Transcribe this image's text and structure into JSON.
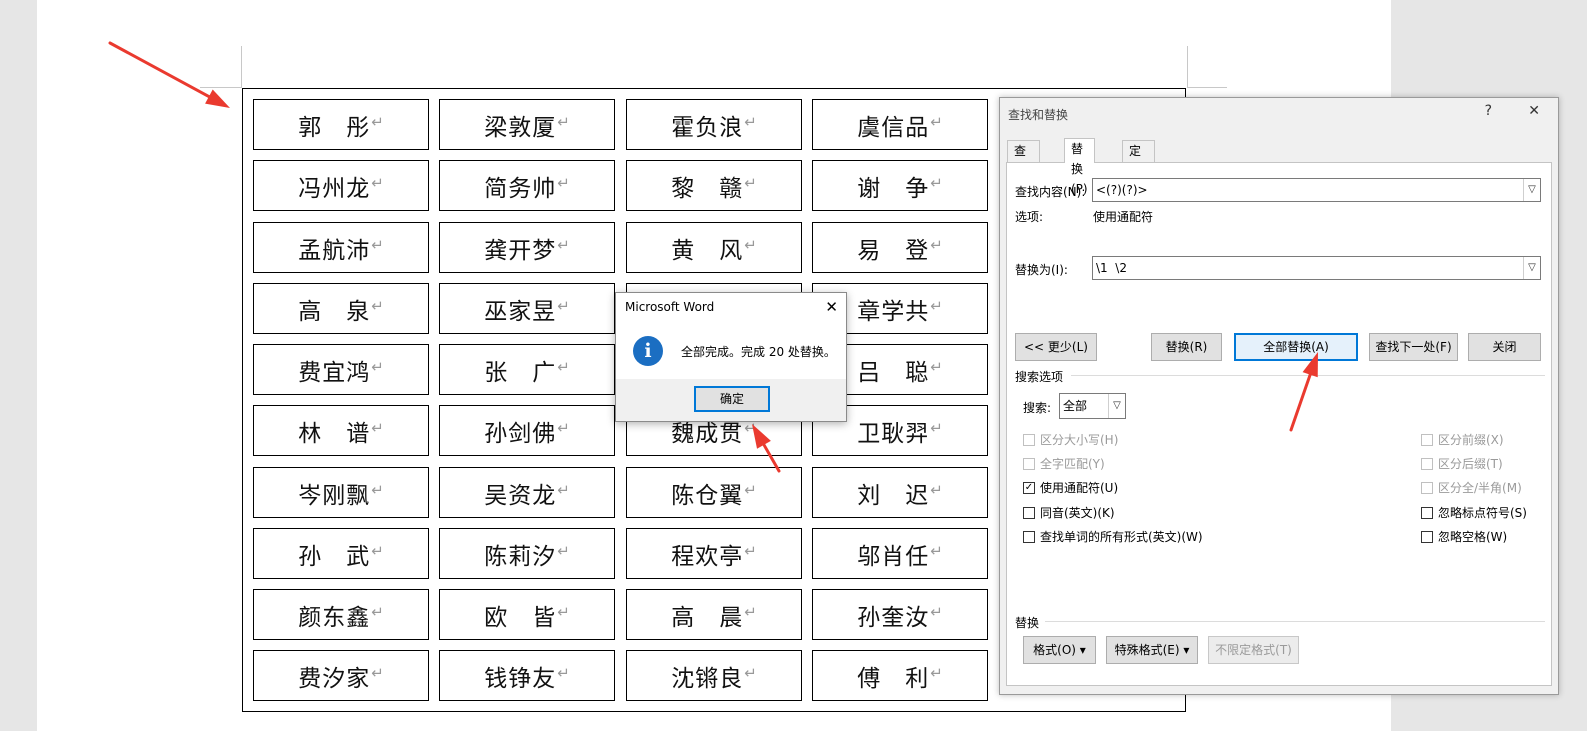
{
  "names": [
    [
      "郭　彤",
      "梁敦厦",
      "霍负浪",
      "虞信品"
    ],
    [
      "冯州龙",
      "简务帅",
      "黎　赣",
      "谢　争"
    ],
    [
      "孟航沛",
      "龚开梦",
      "黄　风",
      "易　登"
    ],
    [
      "高　泉",
      "巫家昱",
      "",
      "章学共"
    ],
    [
      "费宜鸿",
      "张　广",
      "",
      "吕　聪"
    ],
    [
      "林　谱",
      "孙剑佛",
      "魏成贯",
      "卫耿羿"
    ],
    [
      "岑刚飘",
      "吴资龙",
      "陈仓翼",
      "刘　迟"
    ],
    [
      "孙　武",
      "陈莉汐",
      "程欢亭",
      "邬肖任"
    ],
    [
      "颜东鑫",
      "欧　皆",
      "高　晨",
      "孙奎汝"
    ],
    [
      "费汐家",
      "钱铮友",
      "沈锵良",
      "傅　利"
    ]
  ],
  "paragraph_mark": "↵",
  "accent_arrow_color": "#ea3a2f",
  "find_replace": {
    "title": "查找和替换",
    "help_glyph": "?",
    "close_glyph": "✕",
    "tabs": [
      "查找(D)",
      "替换(P)",
      "定位(G)"
    ],
    "find_label": "查找内容(N):",
    "find_value": "<(?)(?)>",
    "options_label": "选项:",
    "options_value": "使用通配符",
    "replace_label": "替换为(I):",
    "replace_value": "\\1  \\2",
    "buttons": {
      "less": "<< 更少(L)",
      "replace": "替换(R)",
      "replace_all": "全部替换(A)",
      "find_next": "查找下一处(F)",
      "close": "关闭"
    },
    "search_options_title": "搜索选项",
    "search_label": "搜索:",
    "search_value": "全部",
    "checks_left": [
      {
        "label": "区分大小写(H)",
        "checked": false,
        "disabled": true
      },
      {
        "label": "全字匹配(Y)",
        "checked": false,
        "disabled": true
      },
      {
        "label": "使用通配符(U)",
        "checked": true,
        "disabled": false
      },
      {
        "label": "同音(英文)(K)",
        "checked": false,
        "disabled": false
      },
      {
        "label": "查找单词的所有形式(英文)(W)",
        "checked": false,
        "disabled": false
      }
    ],
    "checks_right": [
      {
        "label": "区分前缀(X)",
        "checked": false,
        "disabled": true
      },
      {
        "label": "区分后缀(T)",
        "checked": false,
        "disabled": true
      },
      {
        "label": "区分全/半角(M)",
        "checked": false,
        "disabled": true
      },
      {
        "label": "忽略标点符号(S)",
        "checked": false,
        "disabled": false
      },
      {
        "label": "忽略空格(W)",
        "checked": false,
        "disabled": false
      }
    ],
    "replace_section_title": "替换",
    "format_button": "格式(O) ▾",
    "special_button": "特殊格式(E) ▾",
    "no_format_button": "不限定格式(T)"
  },
  "message_box": {
    "title": "Microsoft Word",
    "close_glyph": "✕",
    "info_glyph": "i",
    "text": "全部完成。完成 20 处替换。",
    "ok": "确定"
  }
}
